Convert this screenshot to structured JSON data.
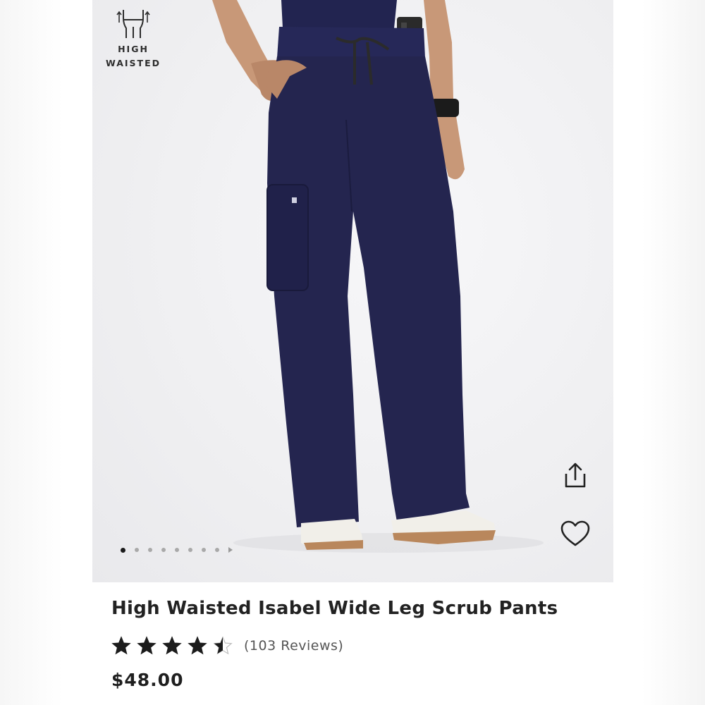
{
  "badge": {
    "icon": "high-waist-icon",
    "line1": "HIGH",
    "line2": "WAISTED"
  },
  "gallery": {
    "image_count": 8,
    "active_index": 0
  },
  "actions": {
    "share_icon": "share-icon",
    "favorite_icon": "heart-icon"
  },
  "product": {
    "title": "High Waisted Isabel Wide Leg Scrub Pants",
    "rating": 4.5,
    "rating_max": 5,
    "reviews_label": "(103 Reviews)",
    "price": "$48.00"
  },
  "colors": {
    "pants": "#24254f",
    "text": "#222222",
    "star": "#1c1c1c"
  }
}
